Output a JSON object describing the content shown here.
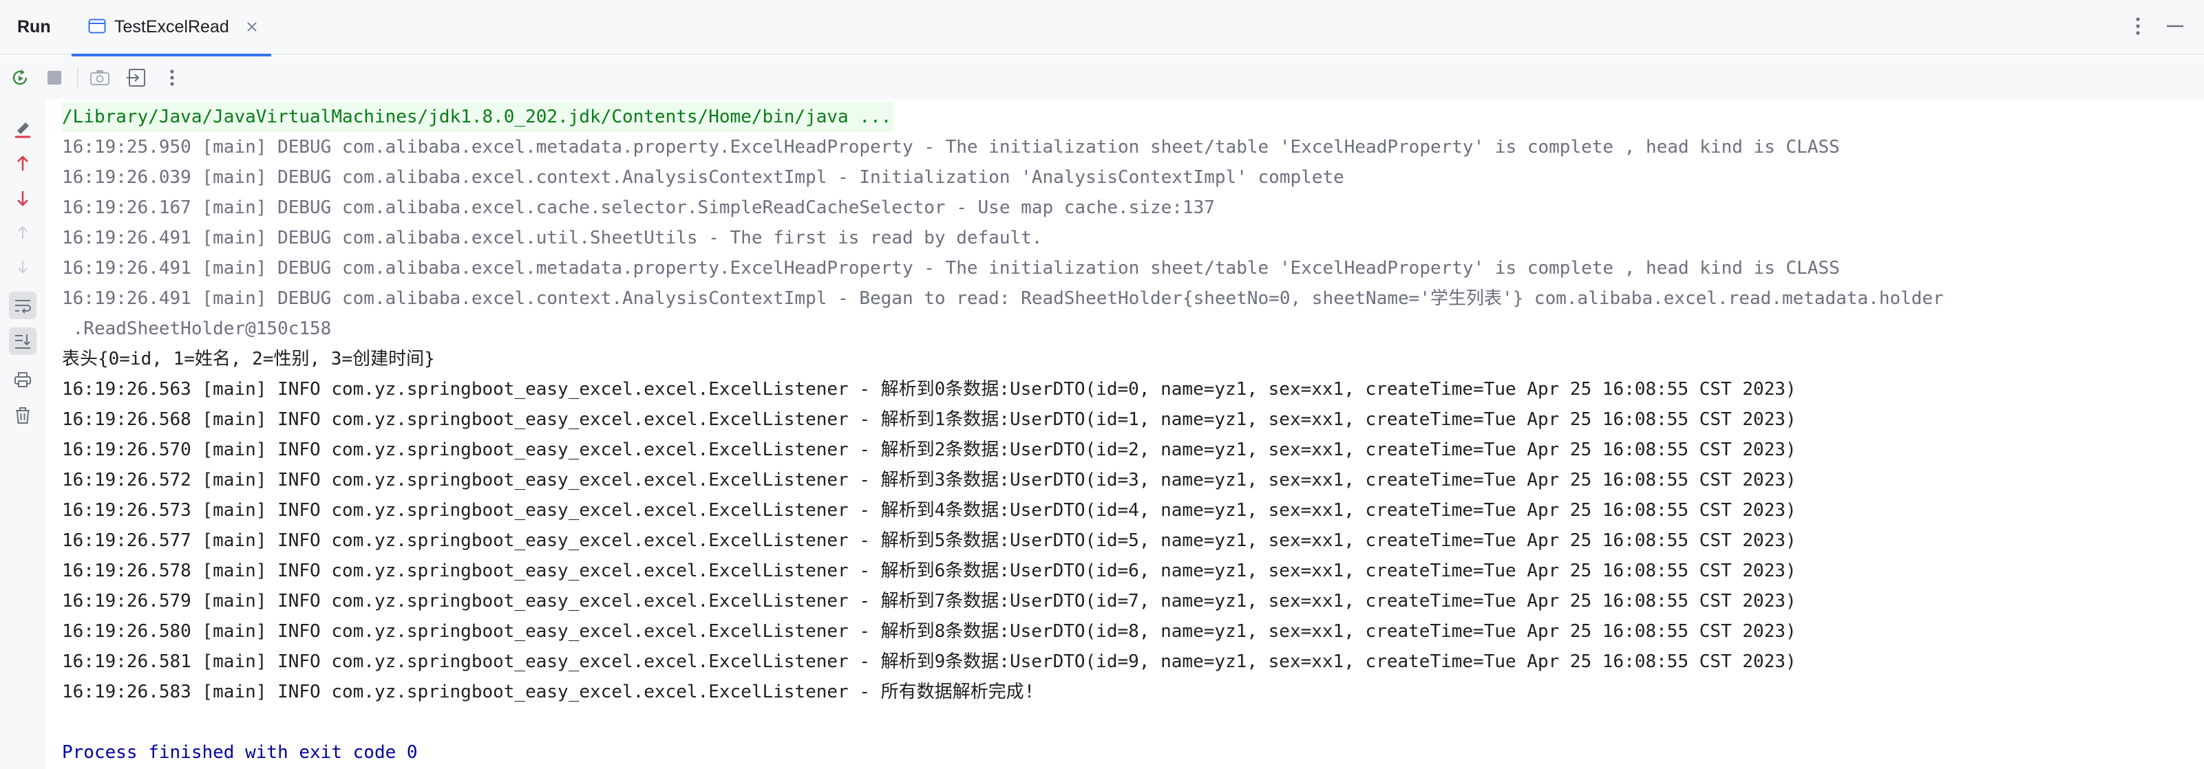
{
  "window": {
    "panel_label": "Run",
    "tab": {
      "title": "TestExcelRead",
      "icon": "run-config-icon"
    }
  },
  "toolbar": {
    "icons": [
      "rerun-icon",
      "stop-icon",
      "camera-icon",
      "exit-icon",
      "more-vertical-icon"
    ]
  },
  "gutter": {
    "icons": [
      "clear-icon",
      "up-arrow-icon",
      "down-arrow-icon",
      "up-arrow-disabled-icon",
      "down-arrow-disabled-icon",
      "soft-wrap-icon",
      "scroll-to-end-icon",
      "print-icon",
      "trash-icon"
    ]
  },
  "console": {
    "lines": [
      "/Library/Java/JavaVirtualMachines/jdk1.8.0_202.jdk/Contents/Home/bin/java ...",
      "16:19:25.950 [main] DEBUG com.alibaba.excel.metadata.property.ExcelHeadProperty - The initialization sheet/table 'ExcelHeadProperty' is complete , head kind is CLASS",
      "16:19:26.039 [main] DEBUG com.alibaba.excel.context.AnalysisContextImpl - Initialization 'AnalysisContextImpl' complete",
      "16:19:26.167 [main] DEBUG com.alibaba.excel.cache.selector.SimpleReadCacheSelector - Use map cache.size:137",
      "16:19:26.491 [main] DEBUG com.alibaba.excel.util.SheetUtils - The first is read by default.",
      "16:19:26.491 [main] DEBUG com.alibaba.excel.metadata.property.ExcelHeadProperty - The initialization sheet/table 'ExcelHeadProperty' is complete , head kind is CLASS",
      "16:19:26.491 [main] DEBUG com.alibaba.excel.context.AnalysisContextImpl - Began to read: ReadSheetHolder{sheetNo=0, sheetName='学生列表'} com.alibaba.excel.read.metadata.holder",
      " .ReadSheetHolder@150c158",
      "表头{0=id, 1=姓名, 2=性别, 3=创建时间}",
      "16:19:26.563 [main] INFO com.yz.springboot_easy_excel.excel.ExcelListener - 解析到0条数据:UserDTO(id=0, name=yz1, sex=xx1, createTime=Tue Apr 25 16:08:55 CST 2023)",
      "16:19:26.568 [main] INFO com.yz.springboot_easy_excel.excel.ExcelListener - 解析到1条数据:UserDTO(id=1, name=yz1, sex=xx1, createTime=Tue Apr 25 16:08:55 CST 2023)",
      "16:19:26.570 [main] INFO com.yz.springboot_easy_excel.excel.ExcelListener - 解析到2条数据:UserDTO(id=2, name=yz1, sex=xx1, createTime=Tue Apr 25 16:08:55 CST 2023)",
      "16:19:26.572 [main] INFO com.yz.springboot_easy_excel.excel.ExcelListener - 解析到3条数据:UserDTO(id=3, name=yz1, sex=xx1, createTime=Tue Apr 25 16:08:55 CST 2023)",
      "16:19:26.573 [main] INFO com.yz.springboot_easy_excel.excel.ExcelListener - 解析到4条数据:UserDTO(id=4, name=yz1, sex=xx1, createTime=Tue Apr 25 16:08:55 CST 2023)",
      "16:19:26.577 [main] INFO com.yz.springboot_easy_excel.excel.ExcelListener - 解析到5条数据:UserDTO(id=5, name=yz1, sex=xx1, createTime=Tue Apr 25 16:08:55 CST 2023)",
      "16:19:26.578 [main] INFO com.yz.springboot_easy_excel.excel.ExcelListener - 解析到6条数据:UserDTO(id=6, name=yz1, sex=xx1, createTime=Tue Apr 25 16:08:55 CST 2023)",
      "16:19:26.579 [main] INFO com.yz.springboot_easy_excel.excel.ExcelListener - 解析到7条数据:UserDTO(id=7, name=yz1, sex=xx1, createTime=Tue Apr 25 16:08:55 CST 2023)",
      "16:19:26.580 [main] INFO com.yz.springboot_easy_excel.excel.ExcelListener - 解析到8条数据:UserDTO(id=8, name=yz1, sex=xx1, createTime=Tue Apr 25 16:08:55 CST 2023)",
      "16:19:26.581 [main] INFO com.yz.springboot_easy_excel.excel.ExcelListener - 解析到9条数据:UserDTO(id=9, name=yz1, sex=xx1, createTime=Tue Apr 25 16:08:55 CST 2023)",
      "16:19:26.583 [main] INFO com.yz.springboot_easy_excel.excel.ExcelListener - 所有数据解析完成!",
      "",
      "Process finished with exit code 0"
    ]
  },
  "colors": {
    "accent": "#3574f0",
    "stop_red": "#db3b4b",
    "debug_gray": "#6c707e",
    "command_green": "#067d17",
    "exit_blue": "#0000a0"
  }
}
